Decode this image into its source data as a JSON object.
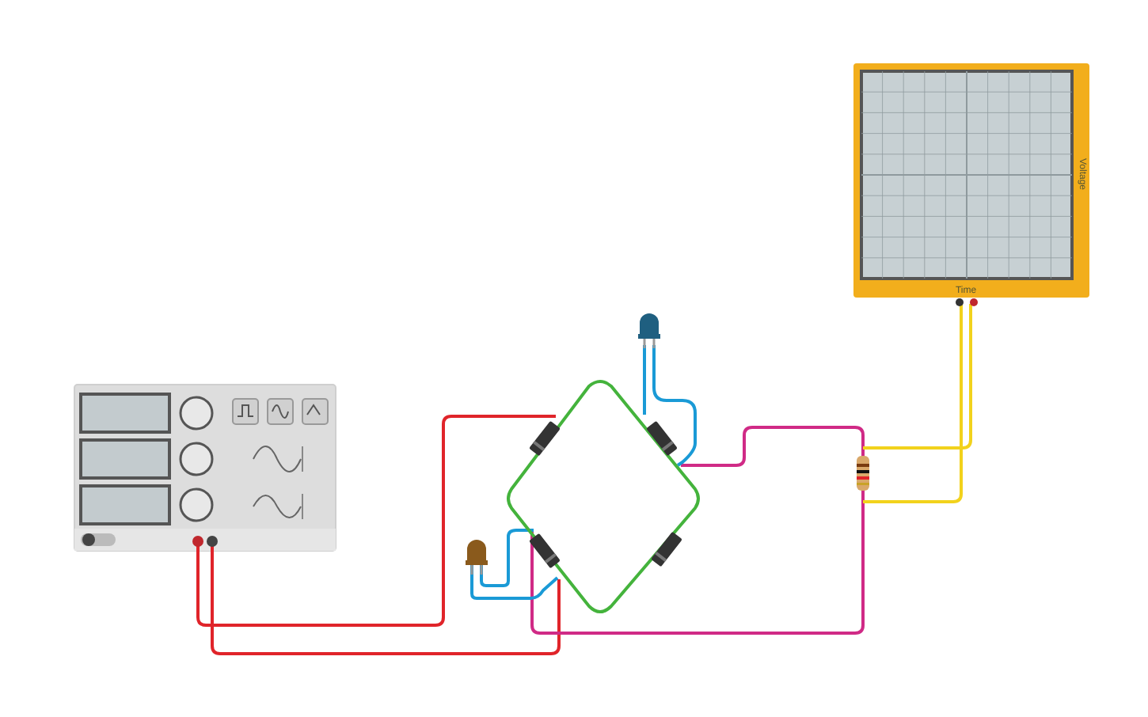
{
  "oscilloscope": {
    "x_label": "Time",
    "y_label": "Voltage"
  },
  "leds": [
    {
      "color": "#1f5f80"
    },
    {
      "color": "#8a5a1c"
    }
  ]
}
